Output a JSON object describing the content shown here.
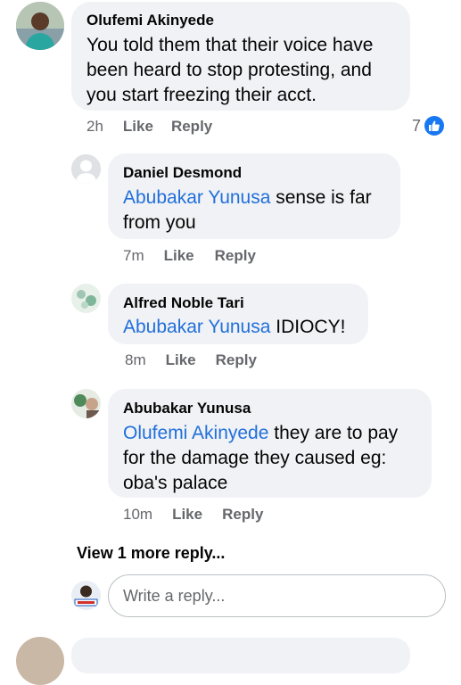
{
  "comment": {
    "author": "Olufemi Akinyede",
    "text": "You told them that their voice have been heard to stop protesting, and you start freezing their acct.",
    "time": "2h",
    "like_label": "Like",
    "reply_label": "Reply",
    "reaction_count": "7",
    "reaction_icon": "thumbs-up-icon",
    "avatar_icon": "user-photo-icon"
  },
  "replies": [
    {
      "author": "Daniel Desmond",
      "mention": "Abubakar Yunusa",
      "text": " sense is far from you",
      "time": "7m",
      "like_label": "Like",
      "reply_label": "Reply",
      "avatar_icon": "default-avatar-icon"
    },
    {
      "author": "Alfred Noble Tari",
      "mention": "Abubakar Yunusa",
      "text": " IDIOCY!",
      "time": "8m",
      "like_label": "Like",
      "reply_label": "Reply",
      "avatar_icon": "user-photo-icon"
    },
    {
      "author": "Abubakar Yunusa",
      "mention": "Olufemi Akinyede",
      "text": " they are to pay for the damage they caused eg: oba's palace",
      "time": "10m",
      "like_label": "Like",
      "reply_label": "Reply",
      "avatar_icon": "user-photo-icon"
    }
  ],
  "view_more": "View 1 more reply...",
  "reply_box": {
    "placeholder": "Write a reply...",
    "avatar_icon": "current-user-avatar-icon"
  },
  "colors": {
    "bubble": "#f0f2f5",
    "mention": "#216fdb",
    "meta": "#65676b",
    "like_badge": "#1877f2"
  }
}
